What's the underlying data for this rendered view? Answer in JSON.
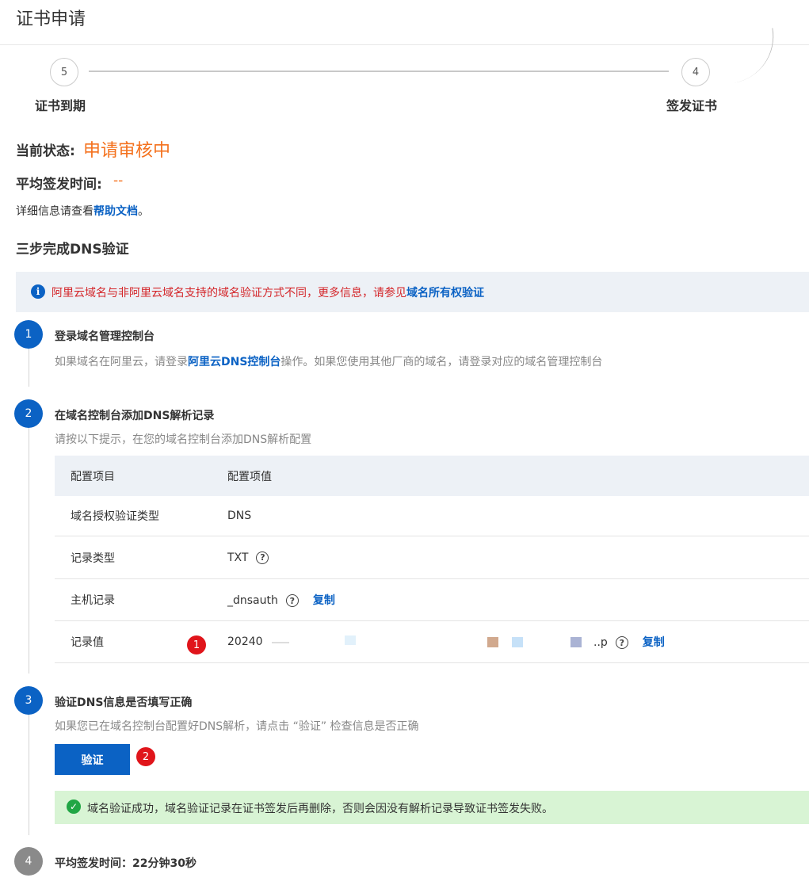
{
  "page": {
    "title": "证书申请"
  },
  "stepper": {
    "left": {
      "number": "5",
      "label": "证书到期"
    },
    "right": {
      "number": "4",
      "label": "签发证书"
    }
  },
  "status": {
    "current_label": "当前状态:",
    "current_value": "申请审核中",
    "avg_label": "平均签发时间:",
    "avg_value": "--",
    "help_prefix": "详细信息请查看",
    "help_link": "帮助文档",
    "help_suffix": "。"
  },
  "dns_section": {
    "title": "三步完成DNS验证",
    "banner": {
      "icon": "info-icon",
      "text": "阿里云域名与非阿里云域名支持的域名验证方式不同，更多信息，请参见",
      "link": "域名所有权验证",
      "color": "#d4262a"
    },
    "steps": [
      {
        "number": "1",
        "title": "登录域名管理控制台",
        "desc_prefix": "如果域名在阿里云，请登录",
        "desc_link": "阿里云DNS控制台",
        "desc_suffix": "操作。如果您使用其他厂商的域名，请登录对应的域名管理控制台"
      },
      {
        "number": "2",
        "title": "在域名控制台添加DNS解析记录",
        "desc": "请按以下提示，在您的域名控制台添加DNS解析配置"
      },
      {
        "number": "3",
        "title": "验证DNS信息是否填写正确",
        "desc": "如果您已在域名控制台配置好DNS解析，请点击 “验证” 检查信息是否正确",
        "button": "验证"
      },
      {
        "number": "4",
        "title": "平均签发时间：22分钟30秒"
      }
    ],
    "table": {
      "headers": [
        "配置项目",
        "配置项值"
      ],
      "rows": [
        {
          "key": "域名授权验证类型",
          "value": "DNS"
        },
        {
          "key": "记录类型",
          "value": "TXT"
        },
        {
          "key": "主机记录",
          "value": "_dnsauth",
          "copy": "复制"
        },
        {
          "key": "记录值",
          "value_start": "20240",
          "value_end": "..p",
          "copy": "复制"
        }
      ]
    },
    "success_message": "域名验证成功，域名验证记录在证书签发后再删除，否则会因没有解析记录导致证书签发失败。"
  },
  "markers": [
    "1",
    "2"
  ],
  "colors": {
    "accent": "#0b62c4",
    "status_orange": "#f4711d",
    "success_bg": "#d8f4d4",
    "success_icon": "#21a645",
    "marker_red": "#e0151b"
  }
}
